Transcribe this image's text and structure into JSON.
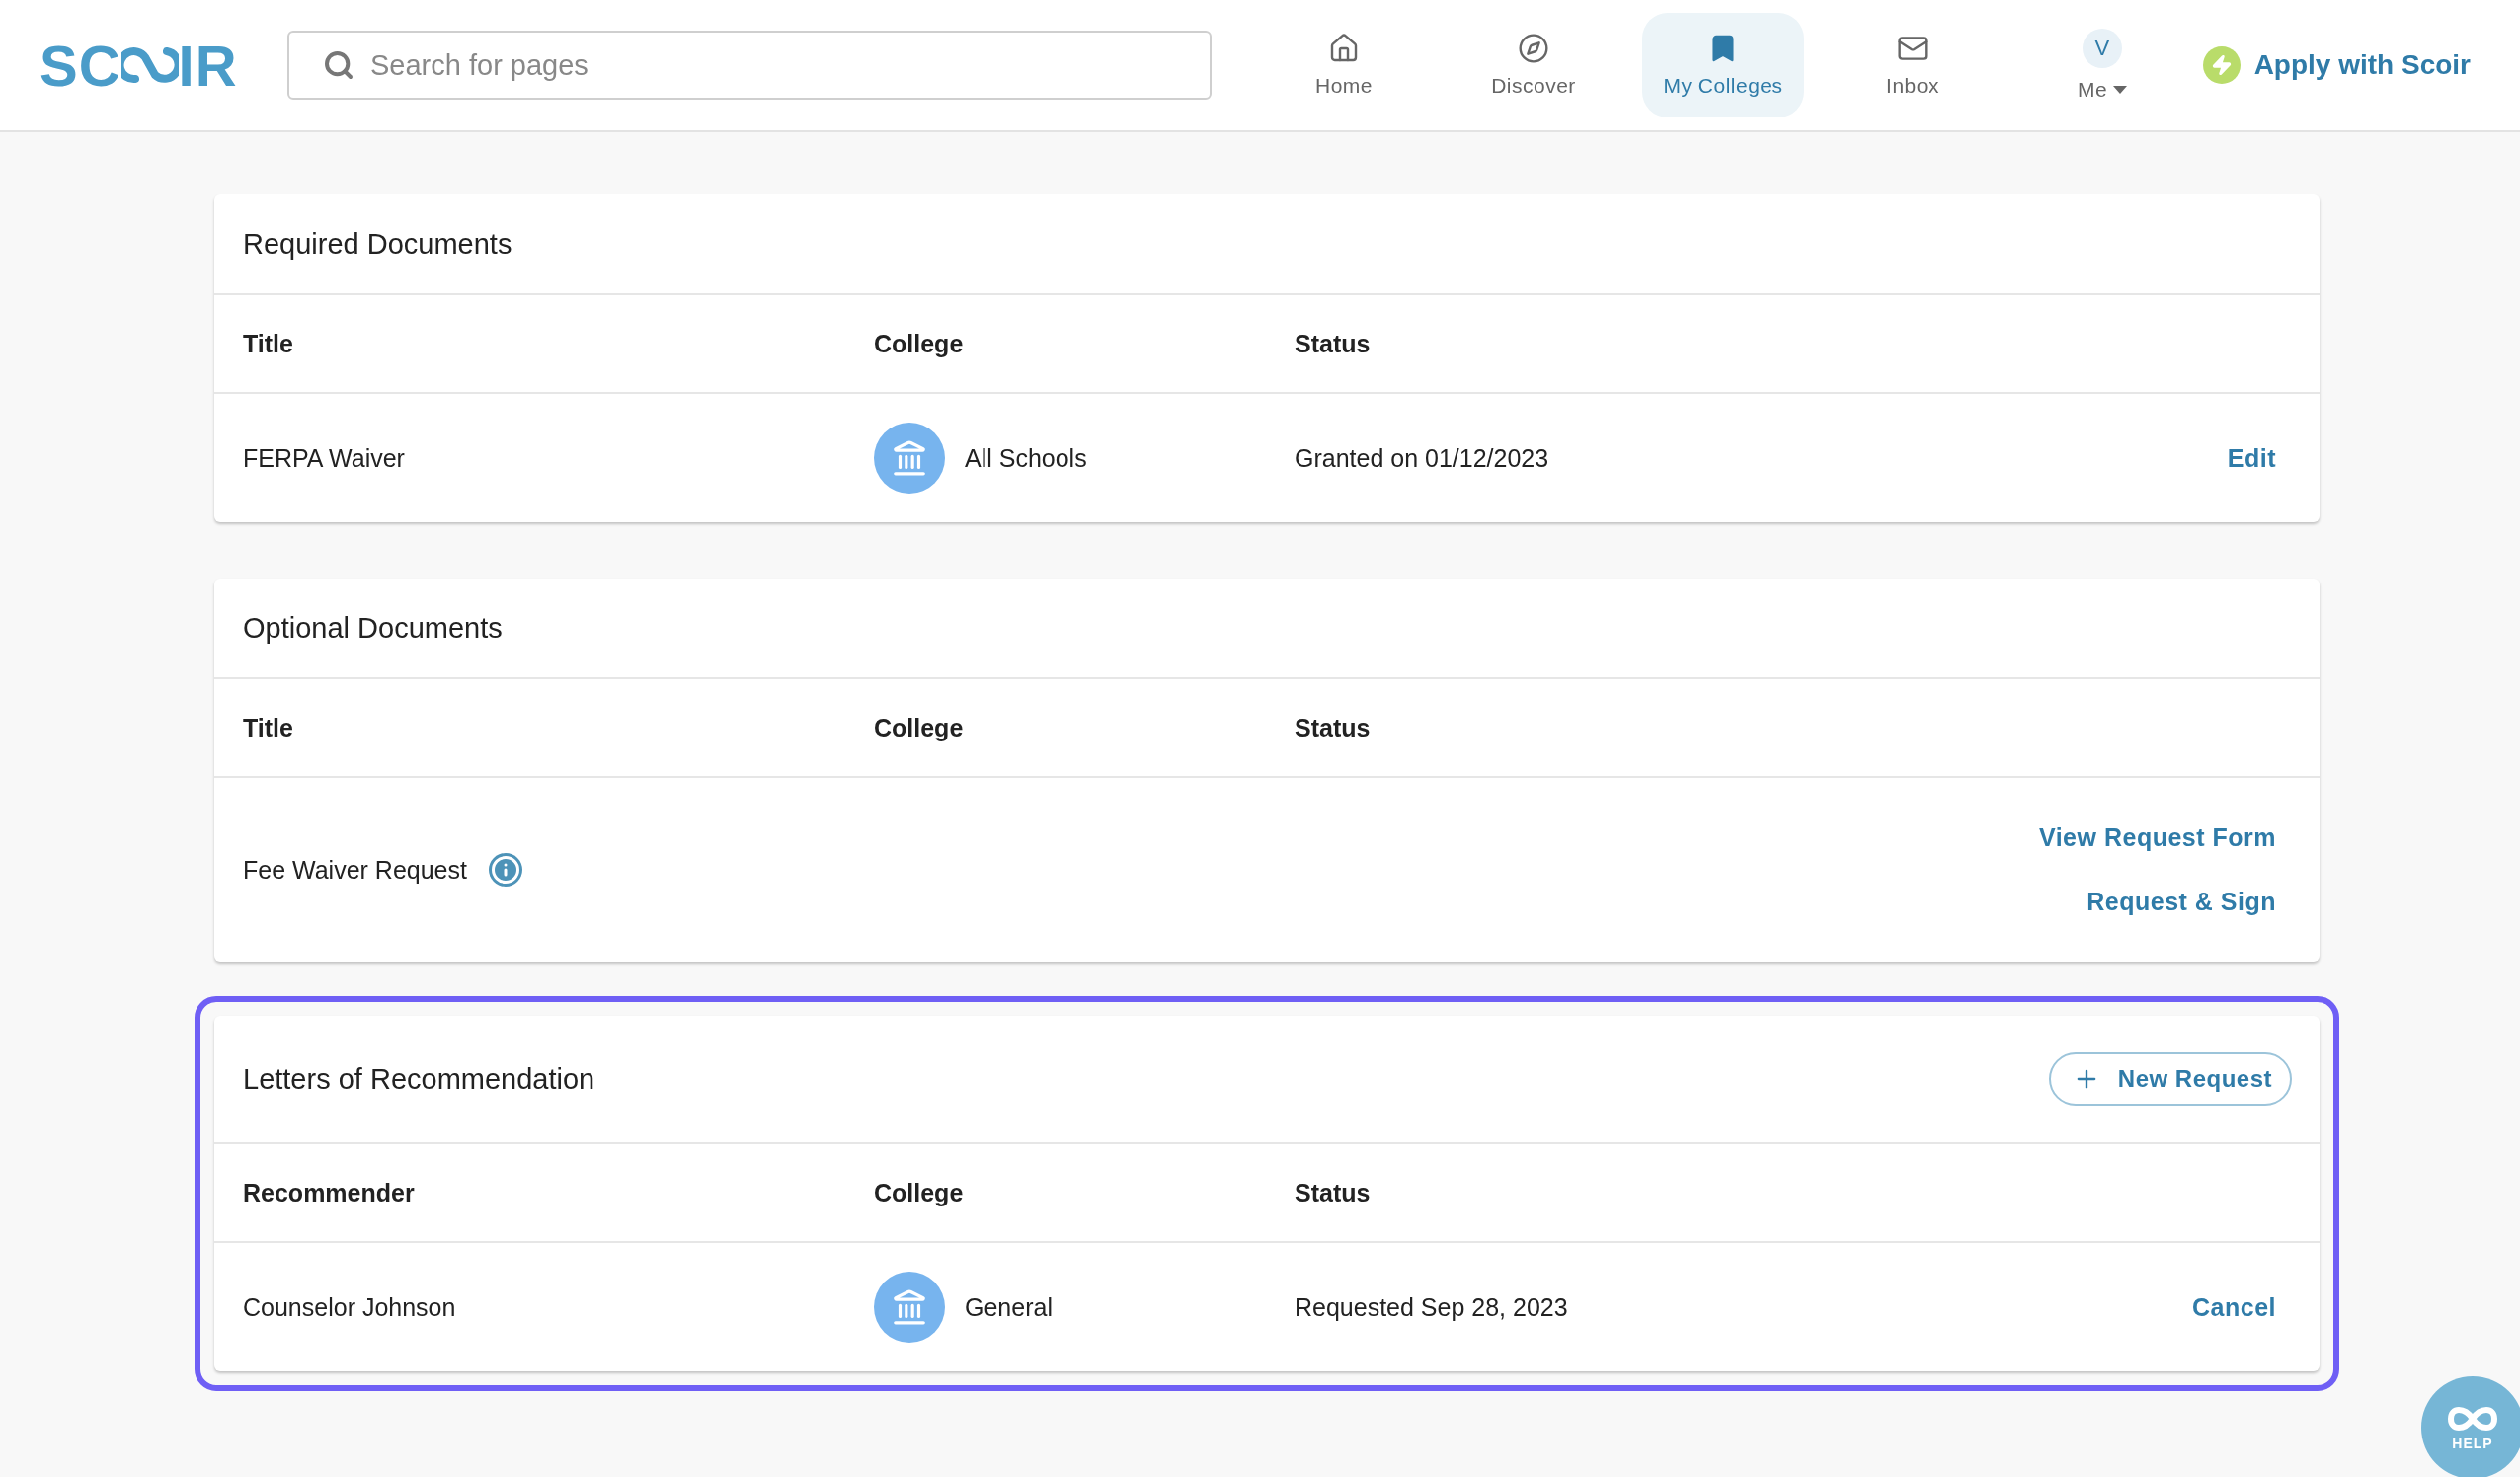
{
  "header": {
    "logo": {
      "left": "SC",
      "right": "IR"
    },
    "search": {
      "placeholder": "Search for pages"
    },
    "nav": [
      {
        "label": "Home",
        "kind": "home",
        "selected": false
      },
      {
        "label": "Discover",
        "kind": "compass",
        "selected": false
      },
      {
        "label": "My Colleges",
        "kind": "bookmark",
        "selected": true
      },
      {
        "label": "Inbox",
        "kind": "mail",
        "selected": false
      },
      {
        "label": "Me",
        "kind": "avatar",
        "avatar": "V",
        "selected": false
      }
    ],
    "apply": "Apply with Scoir"
  },
  "sections": [
    {
      "title": "Required Documents",
      "highlighted": false,
      "columns": [
        "Title",
        "College",
        "Status"
      ],
      "rows": [
        {
          "title": "FERPA Waiver",
          "info": false,
          "college": "All Schools",
          "status": "Granted on 01/12/2023",
          "actions": [
            "Edit"
          ]
        }
      ]
    },
    {
      "title": "Optional Documents",
      "highlighted": false,
      "columns": [
        "Title",
        "College",
        "Status"
      ],
      "rows": [
        {
          "title": "Fee Waiver Request",
          "info": true,
          "actions": [
            "View Request Form",
            "Request & Sign"
          ]
        }
      ]
    },
    {
      "title": "Letters of Recommendation",
      "highlighted": true,
      "button": "New Request",
      "columns": [
        "Recommender",
        "College",
        "Status"
      ],
      "rows": [
        {
          "title": "Counselor Johnson",
          "info": false,
          "college": "General",
          "status": "Requested Sep 28, 2023",
          "actions": [
            "Cancel"
          ]
        }
      ]
    }
  ],
  "help": "HELP"
}
